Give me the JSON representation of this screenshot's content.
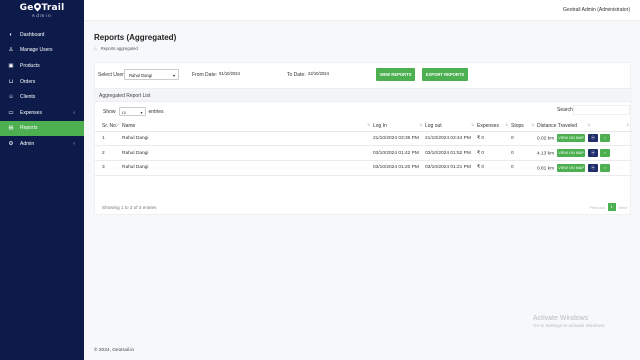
{
  "app": {
    "brand_left": "Ge",
    "brand_right": "Trail",
    "brand_sub": "Admin"
  },
  "sidebar": {
    "items": [
      {
        "label": "Dashboard",
        "icon": "dashboard-icon",
        "glyph": "◐",
        "has_chevron": false,
        "active": false
      },
      {
        "label": "Manage Users",
        "icon": "users-icon",
        "glyph": "♙",
        "has_chevron": false,
        "active": false
      },
      {
        "label": "Products",
        "icon": "box-icon",
        "glyph": "▣",
        "has_chevron": false,
        "active": false
      },
      {
        "label": "Orders",
        "icon": "cart-icon",
        "glyph": "⊔",
        "has_chevron": false,
        "active": false
      },
      {
        "label": "Clients",
        "icon": "clients-icon",
        "glyph": "☺",
        "has_chevron": false,
        "active": false
      },
      {
        "label": "Expenses",
        "icon": "money-icon",
        "glyph": "▭",
        "has_chevron": true,
        "active": false
      },
      {
        "label": "Reports",
        "icon": "report-icon",
        "glyph": "▤",
        "has_chevron": false,
        "active": true
      },
      {
        "label": "Admin",
        "icon": "gear-icon",
        "glyph": "⚙",
        "has_chevron": true,
        "active": false
      }
    ],
    "chevron": "‹",
    "active_color": "#4caf50",
    "bg_color": "#0d1b4a"
  },
  "topbar": {
    "user": "Geotrail Admin (Administrator)"
  },
  "page": {
    "title": "Reports (Aggregated)",
    "breadcrumb_icon": "home-icon",
    "breadcrumb_glyph": "⌂",
    "breadcrumb": "Reports aggregated"
  },
  "filters": {
    "user_label": "Select User:",
    "user_value": "Rahul Dangi",
    "from_label": "From Date:",
    "from_value": "01/10/2024",
    "to_label": "To Date:",
    "to_value": "22/10/2024",
    "view_button": "VIEW REPORTS",
    "export_button": "EXPORT REPORTS"
  },
  "list": {
    "title": "Aggregated Report List",
    "show_label": "Show",
    "length_value": "10",
    "entries_label": "entries",
    "search_label": "Search:",
    "columns": [
      "Sr. No.",
      "Name",
      "Log In",
      "Log out",
      "Expenses",
      "Stops",
      "Distance Traveled",
      ""
    ],
    "rows": [
      {
        "sr": "1",
        "name": "Rahul Dangi",
        "login": "21/10/2024 03:36 PM",
        "logout": "21/10/2024 03:44 PM",
        "expenses": "₹ 0",
        "stops": "0",
        "distance": "0.02 km"
      },
      {
        "sr": "2",
        "name": "Rahul Dangi",
        "login": "03/10/2024 01:42 PM",
        "logout": "03/10/2024 01:52 PM",
        "expenses": "₹ 0",
        "stops": "0",
        "distance": "4.13 km"
      },
      {
        "sr": "3",
        "name": "Rahul Dangi",
        "login": "03/10/2024 01:20 PM",
        "logout": "03/10/2024 01:21 PM",
        "expenses": "₹ 0",
        "stops": "0",
        "distance": "0.81 km"
      }
    ],
    "view_onmap_label": "VIEW ON MAP",
    "location_glyph": "⦿",
    "excel_glyph": "▪",
    "info": "Showing 1 to 3 of 3 entries",
    "prev_label": "Previous",
    "current_page": "1",
    "next_label": "Next"
  },
  "watermark": {
    "line1": "Activate Windows",
    "line2": "Go to Settings to activate Windows."
  },
  "footer": {
    "text": "© 2024, Geotrail.in"
  }
}
